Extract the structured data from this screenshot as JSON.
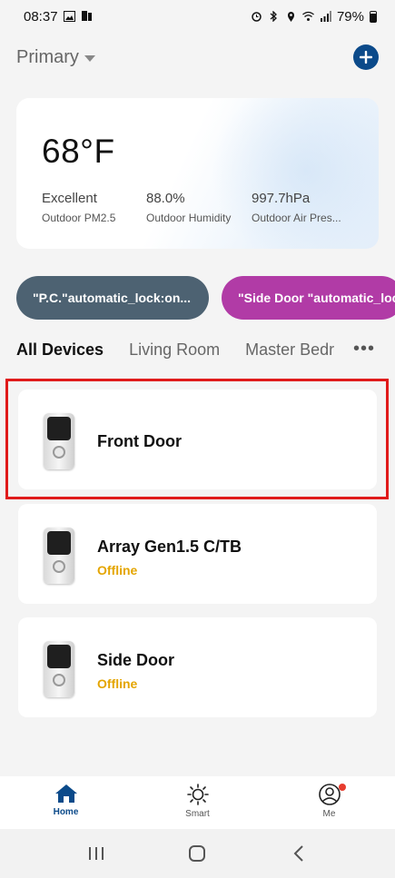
{
  "status_bar": {
    "time": "08:37",
    "battery": "79%"
  },
  "header": {
    "home_name": "Primary"
  },
  "weather": {
    "temperature": "68°F",
    "metrics": [
      {
        "value": "Excellent",
        "label": "Outdoor PM2.5"
      },
      {
        "value": "88.0%",
        "label": "Outdoor Humidity"
      },
      {
        "value": "997.7hPa",
        "label": "Outdoor Air Pres..."
      }
    ]
  },
  "scenes": [
    {
      "label": "\"P.C.\"automatic_lock:on...",
      "color": "#4d6272"
    },
    {
      "label": "\"Side Door \"automatic_lock",
      "color": "#b13ba6"
    }
  ],
  "room_tabs": [
    "All Devices",
    "Living Room",
    "Master Bedr"
  ],
  "devices": [
    {
      "name": "Front Door",
      "status": ""
    },
    {
      "name": "Array Gen1.5 C/TB",
      "status": "Offline"
    },
    {
      "name": "Side Door",
      "status": "Offline"
    }
  ],
  "bottom_nav": [
    {
      "label": "Home",
      "icon": "home-icon"
    },
    {
      "label": "Smart",
      "icon": "sun-icon"
    },
    {
      "label": "Me",
      "icon": "user-icon"
    }
  ],
  "colors": {
    "accent": "#0b4a8a",
    "offline": "#e4a500",
    "highlight": "#e01b1b"
  }
}
